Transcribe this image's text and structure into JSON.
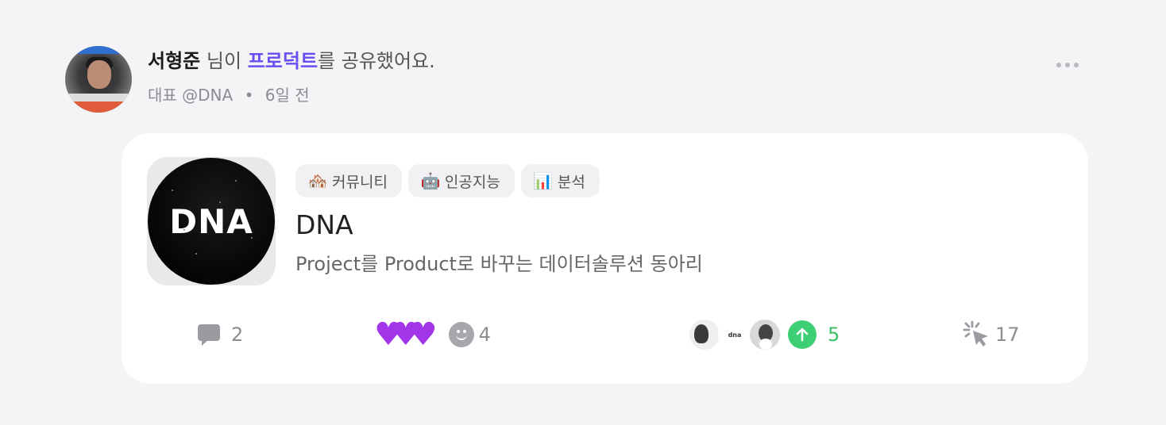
{
  "post": {
    "author_name": "서형준",
    "action_prefix": "님이",
    "action_link": "프로덕트",
    "action_suffix": "를 공유했어요.",
    "author_role": "대표 @DNA",
    "separator": "•",
    "time_ago": "6일 전"
  },
  "product": {
    "logo_text": "DNA",
    "tags": [
      {
        "emoji": "🏘️",
        "icon": "house-icon",
        "label": "커뮤니티"
      },
      {
        "emoji": "🤖",
        "icon": "robot-icon",
        "label": "인공지능"
      },
      {
        "emoji": "📊",
        "icon": "bar-chart-icon",
        "label": "분석"
      }
    ],
    "title": "DNA",
    "description": "Project를 Product로 바꾸는 데이터솔루션 동아리"
  },
  "stats": {
    "comments": "2",
    "reactions": "4",
    "upvotes": "5",
    "clicks": "17",
    "mini_avatar_label": "dna"
  },
  "colors": {
    "accent_link": "#6a4cf0",
    "heart": "#a235e8",
    "upvote": "#3ccf73"
  }
}
